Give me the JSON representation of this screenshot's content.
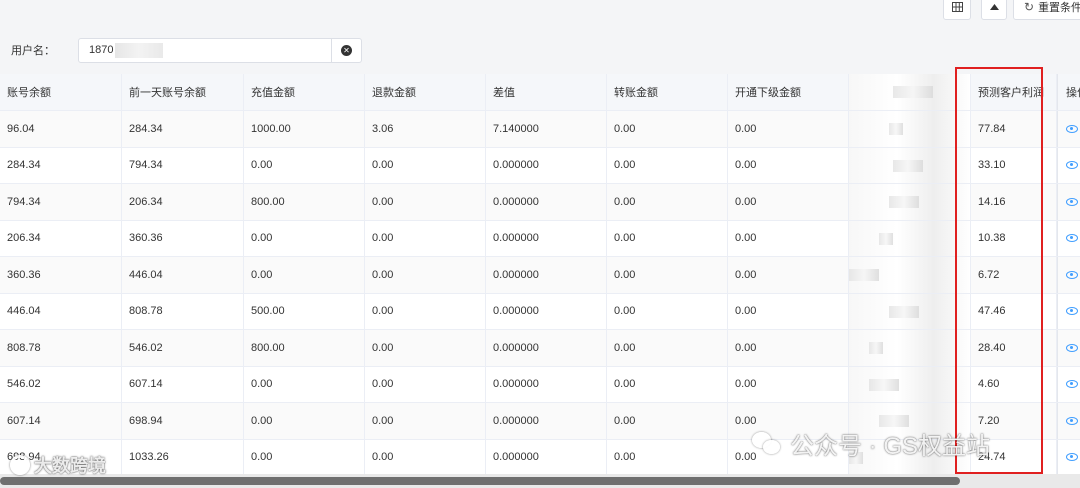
{
  "toolbar": {
    "grid_icon": "grid-icon",
    "collapse_icon": "caret-up-icon",
    "reset_icon": "refresh-icon",
    "reset_label": "重置条件"
  },
  "search": {
    "label": "用户名：",
    "value": "1870"
  },
  "table": {
    "headers": [
      "账号余额",
      "前一天账号余额",
      "充值金额",
      "退款金额",
      "差值",
      "转账金额",
      "开通下级金额",
      "",
      "预测客户利润",
      "操作"
    ],
    "rows": [
      [
        "96.04",
        "284.34",
        "1000.00",
        "3.06",
        "7.140000",
        "0.00",
        "0.00",
        "",
        "77.84"
      ],
      [
        "284.34",
        "794.34",
        "0.00",
        "0.00",
        "0.000000",
        "0.00",
        "0.00",
        "",
        "33.10"
      ],
      [
        "794.34",
        "206.34",
        "800.00",
        "0.00",
        "0.000000",
        "0.00",
        "0.00",
        "",
        "14.16"
      ],
      [
        "206.34",
        "360.36",
        "0.00",
        "0.00",
        "0.000000",
        "0.00",
        "0.00",
        "",
        "10.38"
      ],
      [
        "360.36",
        "446.04",
        "0.00",
        "0.00",
        "0.000000",
        "0.00",
        "0.00",
        "",
        "6.72"
      ],
      [
        "446.04",
        "808.78",
        "500.00",
        "0.00",
        "0.000000",
        "0.00",
        "0.00",
        "",
        "47.46"
      ],
      [
        "808.78",
        "546.02",
        "800.00",
        "0.00",
        "0.000000",
        "0.00",
        "0.00",
        "",
        "28.40"
      ],
      [
        "546.02",
        "607.14",
        "0.00",
        "0.00",
        "0.000000",
        "0.00",
        "0.00",
        "",
        "4.60"
      ],
      [
        "607.14",
        "698.94",
        "0.00",
        "0.00",
        "0.000000",
        "0.00",
        "0.00",
        "",
        "7.20"
      ],
      [
        "698.94",
        "1033.26",
        "0.00",
        "0.00",
        "0.000000",
        "0.00",
        "0.00",
        "",
        "24.74"
      ]
    ],
    "action_icon": "eye-icon"
  },
  "highlight_color": "#e02020",
  "watermarks": {
    "left": "大数跨境",
    "right": "公众号 · GS权益站"
  }
}
